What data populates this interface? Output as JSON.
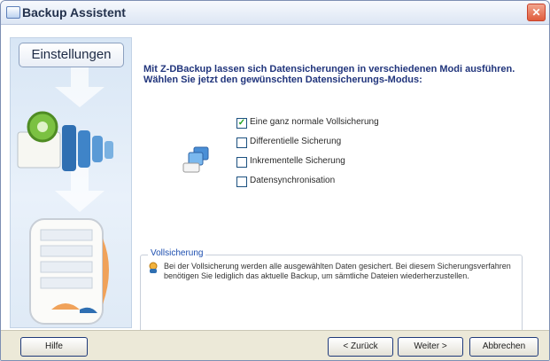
{
  "window": {
    "title": "Backup Assistent"
  },
  "sidebar": {
    "step_label": "Einstellungen"
  },
  "header": {
    "line1": "Mit Z-DBackup lassen sich Datensicherungen in verschiedenen Modi ausführen.",
    "line2": "Wählen Sie jetzt den gewünschten Datensicherungs-Modus:"
  },
  "options": [
    {
      "label": "Eine ganz normale Vollsicherung",
      "checked": true
    },
    {
      "label": "Differentielle Sicherung",
      "checked": false
    },
    {
      "label": "Inkrementelle Sicherung",
      "checked": false
    },
    {
      "label": "Datensynchronisation",
      "checked": false
    }
  ],
  "info": {
    "title": "Vollsicherung",
    "text": "Bei der Vollsicherung werden alle ausgewählten Daten gesichert. Bei diesem Sicherungsverfahren benötigen Sie lediglich das aktuelle Backup, um sämtliche Dateien wiederherzustellen."
  },
  "footer": {
    "help": "Hilfe",
    "back": "< Zurück",
    "next": "Weiter >",
    "cancel": "Abbrechen"
  },
  "colors": {
    "accent": "#21357c",
    "checkmark": "#21a121",
    "close": "#e05c3c"
  }
}
